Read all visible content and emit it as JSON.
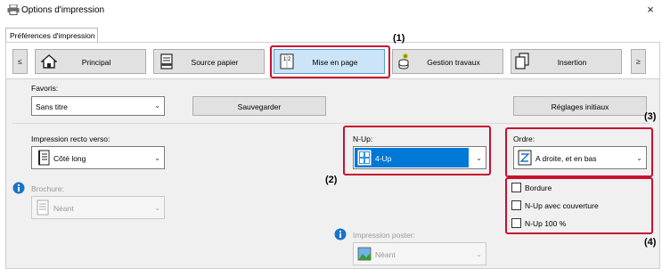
{
  "window": {
    "title": "Options d'impression",
    "close": "×"
  },
  "tab": {
    "label": "Préférences d'impression"
  },
  "toolbar": {
    "prev": "≤",
    "next": "≥",
    "items": [
      "Principal",
      "Source papier",
      "Mise en page",
      "Gestion travaux",
      "Insertion"
    ]
  },
  "favoris": {
    "label": "Favoris:",
    "value": "Sans titre",
    "save": "Sauvegarder",
    "reset": "Réglages initiaux"
  },
  "recto_verso": {
    "label": "Impression recto verso:",
    "value": "Côté long"
  },
  "brochure": {
    "label": "Brochure:",
    "value": "Néant"
  },
  "nup": {
    "label": "N-Up:",
    "value": "4-Up"
  },
  "poster": {
    "label": "Impression poster:",
    "value": "Néant"
  },
  "ordre": {
    "label": "Ordre:",
    "value": "A droite, et en bas"
  },
  "options": [
    "Bordure",
    "N-Up avec couverture",
    "N-Up 100 %"
  ],
  "callouts": [
    "(1)",
    "(2)",
    "(3)",
    "(4)"
  ],
  "colors": {
    "highlight": "#c8102e",
    "selected_blue": "#0078d7",
    "info_blue": "#1a73c8"
  }
}
